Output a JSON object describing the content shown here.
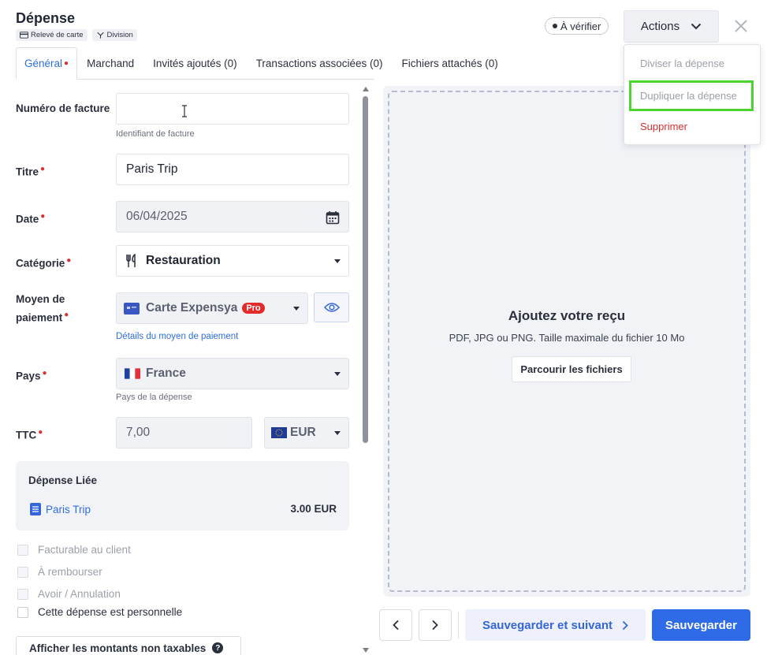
{
  "header": {
    "title": "Dépense",
    "chips": [
      {
        "icon": "credit-card-icon",
        "label": "Relevé de carte"
      },
      {
        "icon": "split-icon",
        "label": "Division"
      }
    ],
    "status": "À vérifier",
    "actions_label": "Actions"
  },
  "tabs": [
    {
      "label": "Général",
      "active": true,
      "required": true
    },
    {
      "label": "Marchand"
    },
    {
      "label": "Invités ajoutés (0)"
    },
    {
      "label": "Transactions associées (0)"
    },
    {
      "label": "Fichiers attachés (0)"
    }
  ],
  "form": {
    "invoice_label": "Numéro de facture",
    "invoice_value": "",
    "invoice_help": "Identifiant de facture",
    "title_label": "Titre",
    "title_value": "Paris Trip",
    "date_label": "Date",
    "date_value": "06/04/2025",
    "category_label": "Catégorie",
    "category_value": "Restauration",
    "payment_label_1": "Moyen de",
    "payment_label_2": "paiement",
    "payment_value": "Carte Expensya",
    "payment_badge": "Pro",
    "payment_details_link": "Détails du moyen de paiement",
    "country_label": "Pays",
    "country_value": "France",
    "country_help": "Pays de la dépense",
    "ttc_label": "TTC",
    "ttc_value": "7,00",
    "currency_value": "EUR"
  },
  "linked_expense": {
    "title": "Dépense Liée",
    "item_label": "Paris Trip",
    "item_amount": "3.00 EUR"
  },
  "checkboxes": [
    {
      "label": "Facturable au client",
      "enabled": false
    },
    {
      "label": "À rembourser",
      "enabled": false
    },
    {
      "label": "Avoir / Annulation",
      "enabled": false
    },
    {
      "label": "Cette dépense est personnelle",
      "enabled": true
    }
  ],
  "nontax_button": "Afficher les montants non taxables",
  "receipt": {
    "title": "Ajoutez votre reçu",
    "subtitle": "PDF, JPG ou PNG. Taille maximale du fichier 10 Mo",
    "browse_label": "Parcourir les fichiers"
  },
  "footer": {
    "save_next_label": "Sauvegarder et suivant",
    "save_label": "Sauvegarder"
  },
  "actions_menu": {
    "items": [
      {
        "label": "Diviser la dépense",
        "state": "disabled"
      },
      {
        "label": "Dupliquer la dépense",
        "state": "highlighted"
      },
      {
        "label": "Supprimer",
        "state": "danger"
      }
    ]
  },
  "colors": {
    "accent": "#2f6be6",
    "danger": "#d8322e",
    "highlight_border": "#4cd430",
    "panel_bg": "#f1f3f7"
  }
}
